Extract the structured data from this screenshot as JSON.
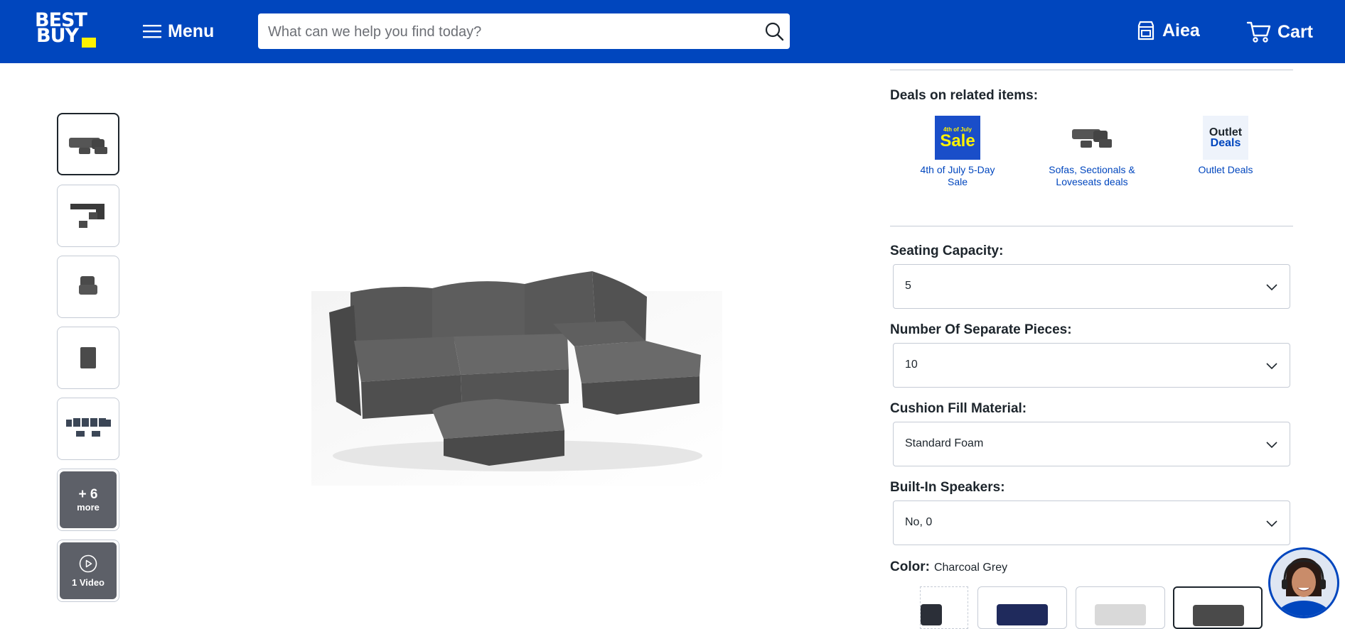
{
  "header": {
    "logo_line1": "BEST",
    "logo_line2": "BUY",
    "menu_label": "Menu",
    "search_placeholder": "What can we help you find today?",
    "store_label": "Aiea",
    "cart_label": "Cart",
    "brand_blue": "#0046be",
    "brand_yellow": "#fff200"
  },
  "gallery": {
    "more_count": "+ 6",
    "more_label": "more",
    "video_label": "1 Video"
  },
  "deals": {
    "heading": "Deals on related items:",
    "items": [
      {
        "label": "4th of July 5-Day Sale",
        "badge_small": "4th of July",
        "badge_big": "Sale"
      },
      {
        "label": "Sofas, Sectionals & Loveseats deals"
      },
      {
        "label": "Outlet Deals",
        "badge_line1": "Outlet",
        "badge_line2": "Deals"
      }
    ]
  },
  "options": {
    "seating": {
      "label": "Seating Capacity:",
      "value": "5"
    },
    "pieces": {
      "label": "Number Of Separate Pieces:",
      "value": "10"
    },
    "cushion": {
      "label": "Cushion Fill Material:",
      "value": "Standard Foam"
    },
    "speakers": {
      "label": "Built-In Speakers:",
      "value": "No, 0"
    },
    "color": {
      "label": "Color:",
      "value": "Charcoal Grey"
    }
  },
  "swatch_colors": [
    "#2b2f38",
    "#1f2a5c",
    "#d9d9d9",
    "#4a4a4a"
  ]
}
